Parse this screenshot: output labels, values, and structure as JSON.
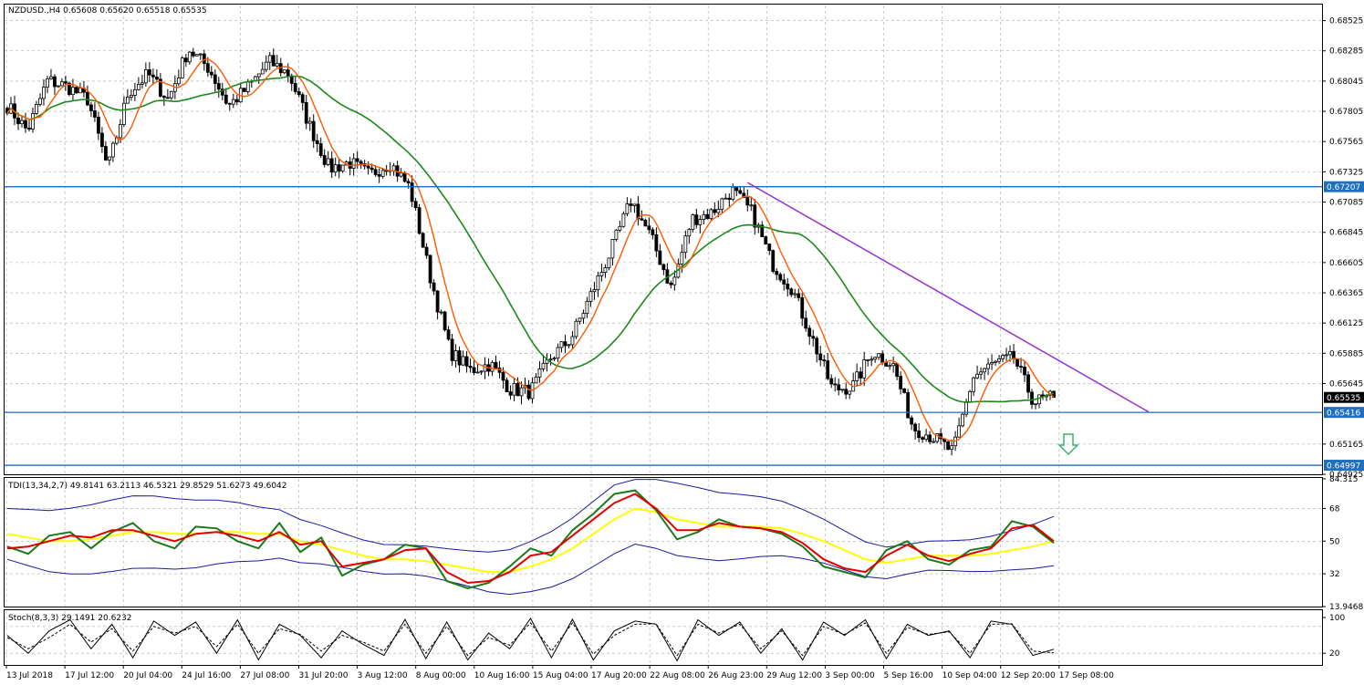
{
  "main_pane": {
    "header": "NZDUSD.,H4  0.65608 0.65620 0.65518 0.65535",
    "y_ticks": [
      "0.68525",
      "0.68285",
      "0.68045",
      "0.67805",
      "0.67565",
      "0.67325",
      "0.67085",
      "0.66845",
      "0.66605",
      "0.66365",
      "0.66125",
      "0.65885",
      "0.65645",
      "0.65165",
      "0.64925"
    ],
    "price_labels": [
      {
        "text": "0.67207",
        "value": 0.67207,
        "kind": "level"
      },
      {
        "text": "0.65535",
        "value": 0.65535,
        "kind": "current"
      },
      {
        "text": "0.65416",
        "value": 0.65416,
        "kind": "level"
      },
      {
        "text": "0.64997",
        "value": 0.64997,
        "kind": "level"
      }
    ]
  },
  "tdi_pane": {
    "header": "TDI(13,34,2,7) 49.8141 63.2113 46.5321 29.8529 51.6273 49.6042",
    "y_ticks": [
      "84.315",
      "68",
      "50",
      "32",
      "13.9468"
    ]
  },
  "stoch_pane": {
    "header": "Stoch(8,3,3) 29.1491 20.6232",
    "y_ticks": [
      "100",
      "20"
    ]
  },
  "x_ticks": [
    "13 Jul 2018",
    "17 Jul 12:00",
    "20 Jul 04:00",
    "24 Jul 16:00",
    "27 Jul 08:00",
    "31 Jul 20:00",
    "3 Aug 12:00",
    "8 Aug 00:00",
    "10 Aug 16:00",
    "15 Aug 04:00",
    "17 Aug 20:00",
    "22 Aug 08:00",
    "26 Aug 23:00",
    "29 Aug 12:00",
    "3 Sep 00:00",
    "5 Sep 16:00",
    "10 Sep 04:00",
    "12 Sep 20:00",
    "17 Sep 08:00"
  ],
  "colors": {
    "background": "#ffffff",
    "grid": "#a9a9a9",
    "candle": "#000000",
    "ma_fast": "#ff5a00",
    "ma_slow": "#1a8a1a",
    "level_line": "#1e6fc0",
    "trendline": "#9932cc",
    "arrow": "#3cb371",
    "current_label_bg": "#000000",
    "tdi_rsi": "#1a7a1a",
    "tdi_signal": "#e00000",
    "tdi_base": "#ffff00",
    "tdi_bands": "#1a1aa0",
    "stoch_main": "#000000",
    "stoch_signal": "#000000"
  },
  "chart_data": [
    {
      "type": "candlestick",
      "title": "NZDUSD.,H4",
      "ylim": [
        0.64925,
        0.68645
      ],
      "anchor_closes": [
        {
          "x": "13 Jul 2018",
          "close": 0.6785
        },
        {
          "x": "15 Jul",
          "close": 0.6765
        },
        {
          "x": "16 Jul",
          "close": 0.6805
        },
        {
          "x": "17 Jul 12:00",
          "close": 0.68
        },
        {
          "x": "18 Jul",
          "close": 0.679
        },
        {
          "x": "19 Jul",
          "close": 0.6735
        },
        {
          "x": "20 Jul 04:00",
          "close": 0.6795
        },
        {
          "x": "21 Jul",
          "close": 0.681
        },
        {
          "x": "23 Jul",
          "close": 0.679
        },
        {
          "x": "24 Jul 16:00",
          "close": 0.683
        },
        {
          "x": "25 Jul",
          "close": 0.6815
        },
        {
          "x": "26 Jul",
          "close": 0.6785
        },
        {
          "x": "27 Jul 08:00",
          "close": 0.68
        },
        {
          "x": "28 Jul",
          "close": 0.682
        },
        {
          "x": "30 Jul",
          "close": 0.681
        },
        {
          "x": "31 Jul 20:00",
          "close": 0.677
        },
        {
          "x": "2 Aug",
          "close": 0.6735
        },
        {
          "x": "3 Aug 12:00",
          "close": 0.674
        },
        {
          "x": "6 Aug",
          "close": 0.673
        },
        {
          "x": "7 Aug",
          "close": 0.674
        },
        {
          "x": "8 Aug 00:00",
          "close": 0.672
        },
        {
          "x": "9 Aug",
          "close": 0.665
        },
        {
          "x": "10 Aug",
          "close": 0.659
        },
        {
          "x": "10 Aug 16:00",
          "close": 0.6575
        },
        {
          "x": "13 Aug",
          "close": 0.658
        },
        {
          "x": "14 Aug",
          "close": 0.656
        },
        {
          "x": "15 Aug 04:00",
          "close": 0.6558
        },
        {
          "x": "16 Aug",
          "close": 0.6585
        },
        {
          "x": "17 Aug",
          "close": 0.66
        },
        {
          "x": "17 Aug 20:00",
          "close": 0.6635
        },
        {
          "x": "20 Aug",
          "close": 0.667
        },
        {
          "x": "21 Aug",
          "close": 0.671
        },
        {
          "x": "22 Aug 08:00",
          "close": 0.668
        },
        {
          "x": "23 Aug",
          "close": 0.664
        },
        {
          "x": "24 Aug",
          "close": 0.6695
        },
        {
          "x": "26 Aug 23:00",
          "close": 0.67
        },
        {
          "x": "27 Aug",
          "close": 0.6718
        },
        {
          "x": "28 Aug",
          "close": 0.67
        },
        {
          "x": "29 Aug 12:00",
          "close": 0.666
        },
        {
          "x": "30 Aug",
          "close": 0.664
        },
        {
          "x": "31 Aug",
          "close": 0.66
        },
        {
          "x": "3 Sep 00:00",
          "close": 0.656
        },
        {
          "x": "4 Sep",
          "close": 0.6562
        },
        {
          "x": "5 Sep 16:00",
          "close": 0.659
        },
        {
          "x": "6 Sep",
          "close": 0.658
        },
        {
          "x": "7 Sep",
          "close": 0.653
        },
        {
          "x": "10 Sep 04:00",
          "close": 0.6522
        },
        {
          "x": "11 Sep",
          "close": 0.651
        },
        {
          "x": "12 Sep",
          "close": 0.657
        },
        {
          "x": "12 Sep 20:00",
          "close": 0.658
        },
        {
          "x": "13 Sep",
          "close": 0.6585
        },
        {
          "x": "14 Sep",
          "close": 0.655
        },
        {
          "x": "17 Sep 08:00",
          "close": 0.65535
        }
      ],
      "indicators": {
        "ma_fast": "orange moving average",
        "ma_slow": "green moving average"
      },
      "horizontal_levels": [
        0.67207,
        0.65416,
        0.64997
      ],
      "trendline": {
        "from": {
          "x": "27 Aug",
          "y": 0.6724
        },
        "to": {
          "x": "18 Sep",
          "y": 0.6542
        }
      },
      "annotation": "down arrow",
      "grid": true
    },
    {
      "type": "line",
      "title": "TDI(13,34,2,7)",
      "ylim": [
        13.9468,
        84.315
      ],
      "series": [
        {
          "values": [
            47,
            43,
            53,
            55,
            46,
            55,
            60,
            50,
            46,
            58,
            57,
            50,
            46,
            60,
            44,
            52,
            31,
            37,
            40,
            48,
            46,
            28,
            24,
            27,
            36,
            46,
            42,
            56,
            65,
            76,
            78,
            67,
            51,
            55,
            62,
            58,
            57,
            54,
            47,
            36,
            33,
            30,
            45,
            50,
            40,
            37,
            45,
            47,
            61,
            58,
            49
          ]
        },
        {
          "values": [
            46,
            47,
            50,
            53,
            52,
            56,
            56,
            53,
            50,
            54,
            55,
            53,
            50,
            55,
            48,
            50,
            36,
            38,
            40,
            45,
            46,
            33,
            27,
            28,
            33,
            42,
            44,
            53,
            62,
            71,
            76,
            68,
            56,
            56,
            60,
            58,
            57,
            55,
            49,
            40,
            35,
            33,
            42,
            48,
            42,
            39,
            43,
            46,
            57,
            59,
            50
          ]
        },
        {
          "values": [
            54,
            52,
            50,
            50,
            51,
            53,
            55,
            55,
            54,
            54,
            55,
            55,
            54,
            54,
            50,
            48,
            45,
            42,
            40,
            40,
            39,
            37,
            35,
            33,
            33,
            36,
            40,
            46,
            54,
            62,
            68,
            66,
            62,
            60,
            58,
            58,
            58,
            57,
            54,
            50,
            45,
            40,
            38,
            40,
            42,
            42,
            42,
            43,
            45,
            47,
            50
          ]
        }
      ],
      "bands": {
        "upper_range": [
          60,
          84
        ],
        "lower_range": [
          18,
          42
        ]
      },
      "grid": true
    },
    {
      "type": "line",
      "title": "Stoch(8,3,3)",
      "ylim": [
        0,
        100
      ],
      "series": [
        {
          "values": [
            60,
            20,
            70,
            95,
            30,
            85,
            10,
            92,
            60,
            90,
            20,
            95,
            5,
            85,
            60,
            10,
            70,
            40,
            15,
            96,
            8,
            90,
            5,
            65,
            30,
            98,
            10,
            96,
            5,
            70,
            92,
            85,
            3,
            95,
            60,
            90,
            20,
            75,
            5,
            90,
            60,
            95,
            8,
            85,
            60,
            70,
            10,
            92,
            85,
            15,
            29
          ]
        },
        {
          "values": [
            55,
            30,
            55,
            85,
            45,
            75,
            25,
            80,
            65,
            80,
            35,
            85,
            20,
            75,
            62,
            25,
            60,
            45,
            25,
            85,
            20,
            80,
            15,
            55,
            38,
            88,
            25,
            88,
            18,
            60,
            85,
            86,
            15,
            85,
            65,
            85,
            30,
            70,
            15,
            80,
            62,
            88,
            20,
            78,
            62,
            68,
            20,
            85,
            86,
            25,
            21
          ]
        }
      ],
      "grid": true
    }
  ]
}
